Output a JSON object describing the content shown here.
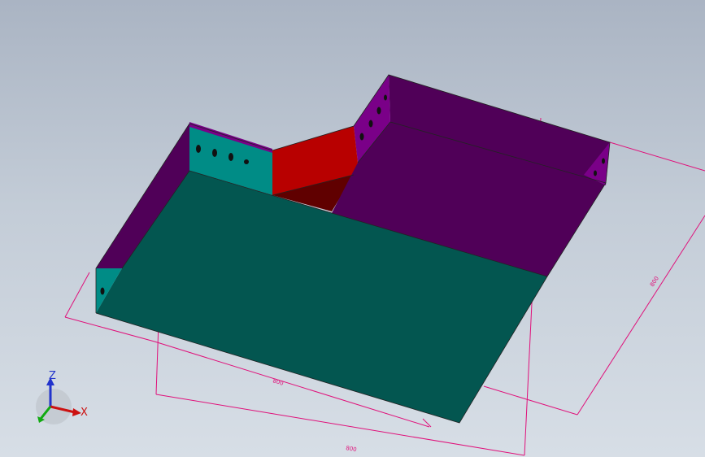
{
  "viewport": {
    "background_top": "#aab4c3",
    "background_bottom": "#d7dee6"
  },
  "model": {
    "colors": {
      "floor": "#035650",
      "purple_wall": "#500058",
      "purple_wall_light": "#7a0088",
      "teal_end_plate": "#008c86",
      "red_bend": "#b80000",
      "dark_red_shadow": "#600000",
      "dimension_lines": "#e0107a"
    }
  },
  "dimensions": {
    "bottom_inner": "800",
    "bottom_outer": "800",
    "right_side": "800"
  },
  "triad": {
    "z_label": "Z",
    "x_label": "X",
    "colors": {
      "z": "#2233cc",
      "x": "#cc1111",
      "y": "#11aa11"
    }
  }
}
